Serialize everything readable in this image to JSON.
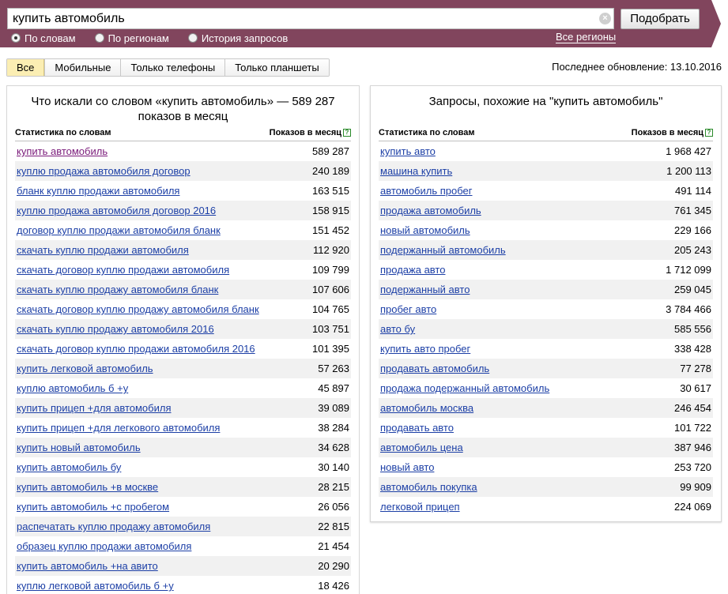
{
  "search": {
    "query": "купить автомобиль",
    "button_label": "Подобрать",
    "clear_symbol": "×"
  },
  "modes": [
    {
      "label": "По словам",
      "checked": true
    },
    {
      "label": "По регионам",
      "checked": false
    },
    {
      "label": "История запросов",
      "checked": false
    }
  ],
  "regions_link": "Все регионы",
  "tabs": [
    {
      "label": "Все",
      "active": true
    },
    {
      "label": "Мобильные",
      "active": false
    },
    {
      "label": "Только телефоны",
      "active": false
    },
    {
      "label": "Только планшеты",
      "active": false
    }
  ],
  "last_update": "Последнее обновление: 13.10.2016",
  "colors": {
    "header_bg": "#81455d",
    "link": "#1c3fa6",
    "visited_link": "#7a1a7a",
    "active_tab": "#fbeeb3",
    "row_stripe": "#f1f1f1"
  },
  "left_panel": {
    "title": "Что искали со словом «купить автомобиль» — 589 287 показов в месяц",
    "col_phrase": "Статистика по словам",
    "col_count": "Показов в месяц",
    "help_symbol": "?",
    "rows": [
      {
        "phrase": "купить автомобиль",
        "count": "589 287",
        "visited": true
      },
      {
        "phrase": "куплю продажа автомобиля договор",
        "count": "240 189"
      },
      {
        "phrase": "бланк куплю продажи автомобиля",
        "count": "163 515"
      },
      {
        "phrase": "куплю продажа автомобиля договор 2016",
        "count": "158 915"
      },
      {
        "phrase": "договор куплю продажи автомобиля бланк",
        "count": "151 452"
      },
      {
        "phrase": "скачать куплю продажи автомобиля",
        "count": "112 920"
      },
      {
        "phrase": "скачать договор куплю продажи автомобиля",
        "count": "109 799"
      },
      {
        "phrase": "скачать куплю продажу автомобиля бланк",
        "count": "107 606"
      },
      {
        "phrase": "скачать договор куплю продажу автомобиля бланк",
        "count": "104 765"
      },
      {
        "phrase": "скачать куплю продажу автомобиля 2016",
        "count": "103 751"
      },
      {
        "phrase": "скачать договор куплю продажи автомобиля 2016",
        "count": "101 395"
      },
      {
        "phrase": "купить легковой автомобиль",
        "count": "57 263"
      },
      {
        "phrase": "куплю автомобиль б +у",
        "count": "45 897"
      },
      {
        "phrase": "купить прицеп +для автомобиля",
        "count": "39 089"
      },
      {
        "phrase": "купить прицеп +для легкового автомобиля",
        "count": "38 284"
      },
      {
        "phrase": "купить новый автомобиль",
        "count": "34 628"
      },
      {
        "phrase": "купить автомобиль бу",
        "count": "30 140"
      },
      {
        "phrase": "купить автомобиль +в москве",
        "count": "28 215"
      },
      {
        "phrase": "купить автомобиль +с пробегом",
        "count": "26 056"
      },
      {
        "phrase": "распечатать куплю продажу автомобиля",
        "count": "22 815"
      },
      {
        "phrase": "образец куплю продажи автомобиля",
        "count": "21 454"
      },
      {
        "phrase": "купить автомобиль +на авито",
        "count": "20 290"
      },
      {
        "phrase": "куплю легковой автомобиль б +у",
        "count": "18 426"
      }
    ]
  },
  "right_panel": {
    "title": "Запросы, похожие на \"купить автомобиль\"",
    "col_phrase": "Статистика по словам",
    "col_count": "Показов в месяц",
    "help_symbol": "?",
    "rows": [
      {
        "phrase": "купить авто",
        "count": "1 968 427"
      },
      {
        "phrase": "машина купить",
        "count": "1 200 113"
      },
      {
        "phrase": "автомобиль пробег",
        "count": "491 114"
      },
      {
        "phrase": "продажа автомобиль",
        "count": "761 345"
      },
      {
        "phrase": "новый автомобиль",
        "count": "229 166"
      },
      {
        "phrase": "подержанный автомобиль",
        "count": "205 243"
      },
      {
        "phrase": "продажа авто",
        "count": "1 712 099"
      },
      {
        "phrase": "подержанный авто",
        "count": "259 045"
      },
      {
        "phrase": "пробег авто",
        "count": "3 784 466"
      },
      {
        "phrase": "авто бу",
        "count": "585 556"
      },
      {
        "phrase": "купить авто пробег",
        "count": "338 428"
      },
      {
        "phrase": "продавать автомобиль",
        "count": "77 278"
      },
      {
        "phrase": "продажа подержанный автомобиль",
        "count": "30 617"
      },
      {
        "phrase": "автомобиль москва",
        "count": "246 454"
      },
      {
        "phrase": "продавать авто",
        "count": "101 722"
      },
      {
        "phrase": "автомобиль цена",
        "count": "387 946"
      },
      {
        "phrase": "новый авто",
        "count": "253 720"
      },
      {
        "phrase": "автомобиль покупка",
        "count": "99 909"
      },
      {
        "phrase": "легковой прицеп",
        "count": "224 069"
      }
    ]
  }
}
